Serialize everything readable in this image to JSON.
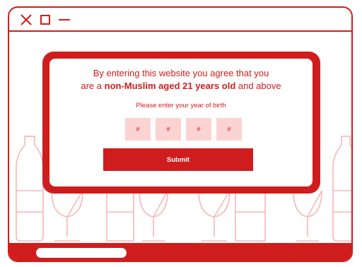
{
  "theme": {
    "accent": "#cf1d1d",
    "input_bg": "#fbd3d3",
    "decor": "#f7b7b7"
  },
  "window": {
    "controls": [
      "close-icon",
      "maximize-icon",
      "minimize-icon"
    ]
  },
  "modal": {
    "headline_line1": "By entering this website you agree that you",
    "headline_line2_prefix": "are a ",
    "headline_line2_bold": "non-Muslim aged 21 years old",
    "headline_line2_suffix": " and above",
    "instruction": "Please enter your year of birth",
    "digit_placeholders": [
      "#",
      "#",
      "#",
      "#"
    ],
    "submit_label": "Submit"
  }
}
